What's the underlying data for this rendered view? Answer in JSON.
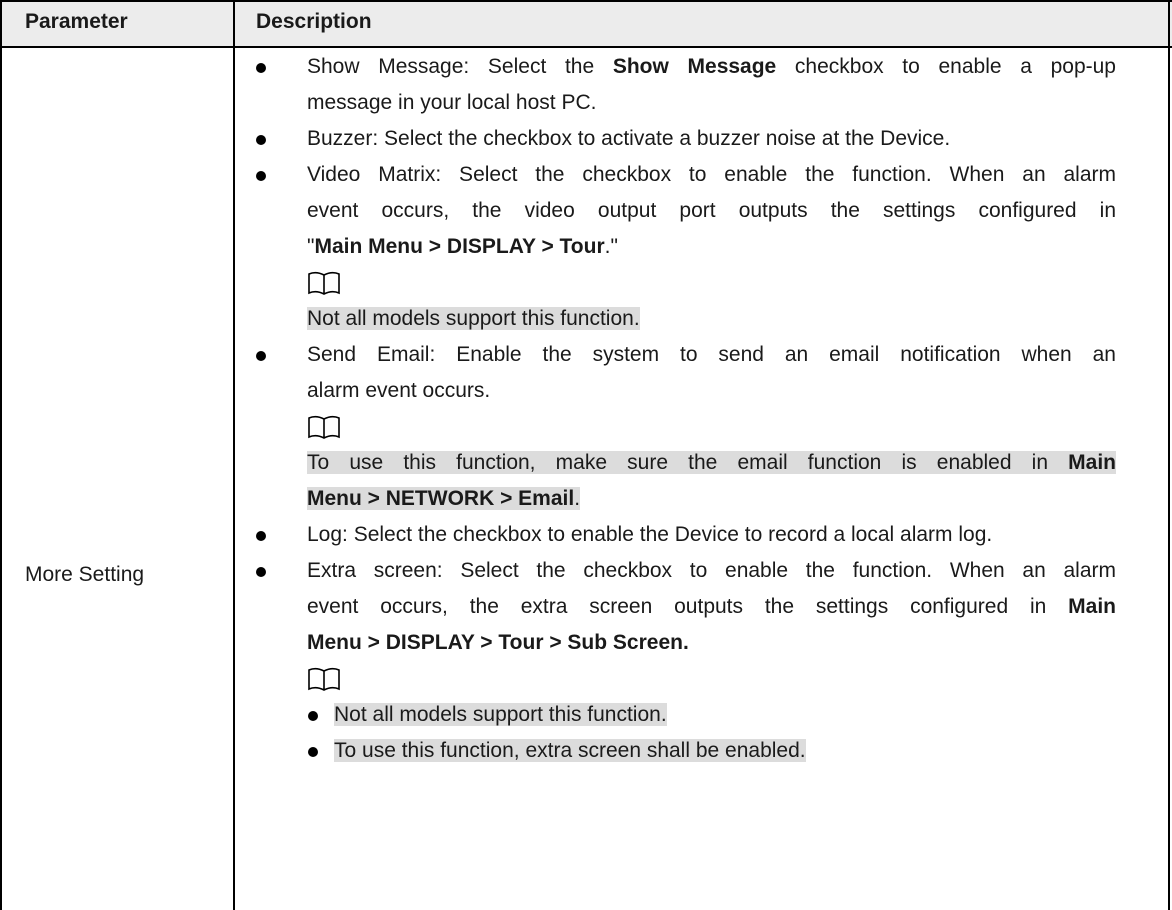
{
  "header": {
    "col1": "Parameter",
    "col2": "Description"
  },
  "row": {
    "param": "More Setting",
    "items": [
      {
        "a": "Show Message: Select the ",
        "b": "Show Message",
        "c": " checkbox to enable a pop-up",
        "d": "message in your local host PC."
      },
      {
        "a": "Buzzer: Select the checkbox to activate a buzzer noise at the Device."
      },
      {
        "a": "Video Matrix: Select the checkbox to enable the function. When an alarm",
        "b": "event occurs, the video output port outputs the settings configured in",
        "c1": "\"",
        "c2": "Main Menu > DISPLAY > Tour",
        "c3": ".\"",
        "note": "Not all models support this function."
      },
      {
        "a": "Send Email: Enable the system to send an email notification when an",
        "b": "alarm event occurs.",
        "note1": "To use this function, make sure the email function is enabled in ",
        "note1b": "Main",
        "note2": "Menu > NETWORK > Email",
        "note2b": "."
      },
      {
        "a": "Log: Select the checkbox to enable the Device to record a local alarm log."
      },
      {
        "a": "Extra screen: Select the checkbox to enable the function. When an alarm",
        "b": "event occurs, the extra screen outputs the settings configured in ",
        "bb": "Main",
        "c": "Menu > DISPLAY > Tour > Sub Screen.",
        "notes": [
          "Not all models support this function.",
          "To use this function, extra screen shall be enabled."
        ]
      }
    ]
  },
  "icons": {
    "note": "book-note-icon"
  }
}
